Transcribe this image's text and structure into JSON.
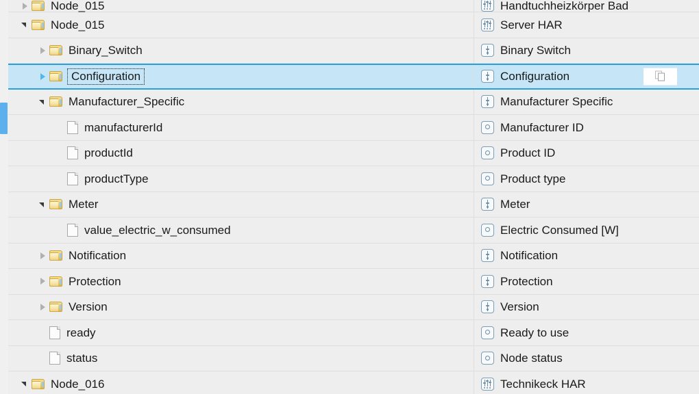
{
  "scrollbar": {
    "present": true
  },
  "selection": {
    "row_key": "Configuration",
    "accent_color": "#2a9fd8",
    "fill_color": "#c6e6f7"
  },
  "overlay_button": {
    "name": "copy-button",
    "icon": "copy-icon"
  },
  "colors": {
    "row_background": "#eeeeee",
    "row_separator": "#dedede",
    "text": "#1a1a1a",
    "folder": "#edc85f",
    "type_icon_stroke": "#6b8ca3",
    "scrollbar_thumb": "#5cb0ee"
  },
  "rows": [
    {
      "name": "Node_015",
      "label": "Handtuchheizkörper Bad",
      "indent": 1,
      "twisty": "collapsed",
      "icon": "folder-icon",
      "type_icon": "slider3-icon",
      "clipped": true,
      "selected": false
    },
    {
      "name": "Node_015",
      "label": "Server HAR",
      "indent": 1,
      "twisty": "expanded",
      "icon": "folder-icon",
      "type_icon": "slider3-icon",
      "clipped": false,
      "selected": false
    },
    {
      "name": "Binary_Switch",
      "label": "Binary Switch",
      "indent": 2,
      "twisty": "collapsed",
      "icon": "folder-icon",
      "type_icon": "slider1-icon",
      "clipped": false,
      "selected": false
    },
    {
      "name": "Configuration",
      "label": "Configuration",
      "indent": 2,
      "twisty": "collapsed",
      "icon": "folder-icon",
      "type_icon": "slider1-icon",
      "clipped": false,
      "selected": true
    },
    {
      "name": "Manufacturer_Specific",
      "label": "Manufacturer Specific",
      "indent": 2,
      "twisty": "expanded",
      "icon": "folder-icon",
      "type_icon": "slider1-icon",
      "clipped": false,
      "selected": false
    },
    {
      "name": "manufacturerId",
      "label": "Manufacturer ID",
      "indent": 3,
      "twisty": "none",
      "icon": "file-icon",
      "type_icon": "circle-icon",
      "clipped": false,
      "selected": false
    },
    {
      "name": "productId",
      "label": "Product ID",
      "indent": 3,
      "twisty": "none",
      "icon": "file-icon",
      "type_icon": "circle-icon",
      "clipped": false,
      "selected": false
    },
    {
      "name": "productType",
      "label": "Product type",
      "indent": 3,
      "twisty": "none",
      "icon": "file-icon",
      "type_icon": "circle-icon",
      "clipped": false,
      "selected": false
    },
    {
      "name": "Meter",
      "label": "Meter",
      "indent": 2,
      "twisty": "expanded",
      "icon": "folder-icon",
      "type_icon": "slider1-icon",
      "clipped": false,
      "selected": false
    },
    {
      "name": "value_electric_w_consumed",
      "label": "Electric Consumed [W]",
      "indent": 3,
      "twisty": "none",
      "icon": "file-icon",
      "type_icon": "circle-icon",
      "clipped": false,
      "selected": false
    },
    {
      "name": "Notification",
      "label": "Notification",
      "indent": 2,
      "twisty": "collapsed",
      "icon": "folder-icon",
      "type_icon": "slider1-icon",
      "clipped": false,
      "selected": false
    },
    {
      "name": "Protection",
      "label": "Protection",
      "indent": 2,
      "twisty": "collapsed",
      "icon": "folder-icon",
      "type_icon": "slider1-icon",
      "clipped": false,
      "selected": false
    },
    {
      "name": "Version",
      "label": "Version",
      "indent": 2,
      "twisty": "collapsed",
      "icon": "folder-icon",
      "type_icon": "slider1-icon",
      "clipped": false,
      "selected": false
    },
    {
      "name": "ready",
      "label": "Ready to use",
      "indent": 2,
      "twisty": "none",
      "icon": "file-icon",
      "type_icon": "circle-icon",
      "clipped": false,
      "selected": false
    },
    {
      "name": "status",
      "label": "Node status",
      "indent": 2,
      "twisty": "none",
      "icon": "file-icon",
      "type_icon": "circle-icon",
      "clipped": false,
      "selected": false
    },
    {
      "name": "Node_016",
      "label": "Technikeck HAR",
      "indent": 1,
      "twisty": "expanded",
      "icon": "folder-icon",
      "type_icon": "slider3-icon",
      "clipped": false,
      "selected": false
    }
  ]
}
